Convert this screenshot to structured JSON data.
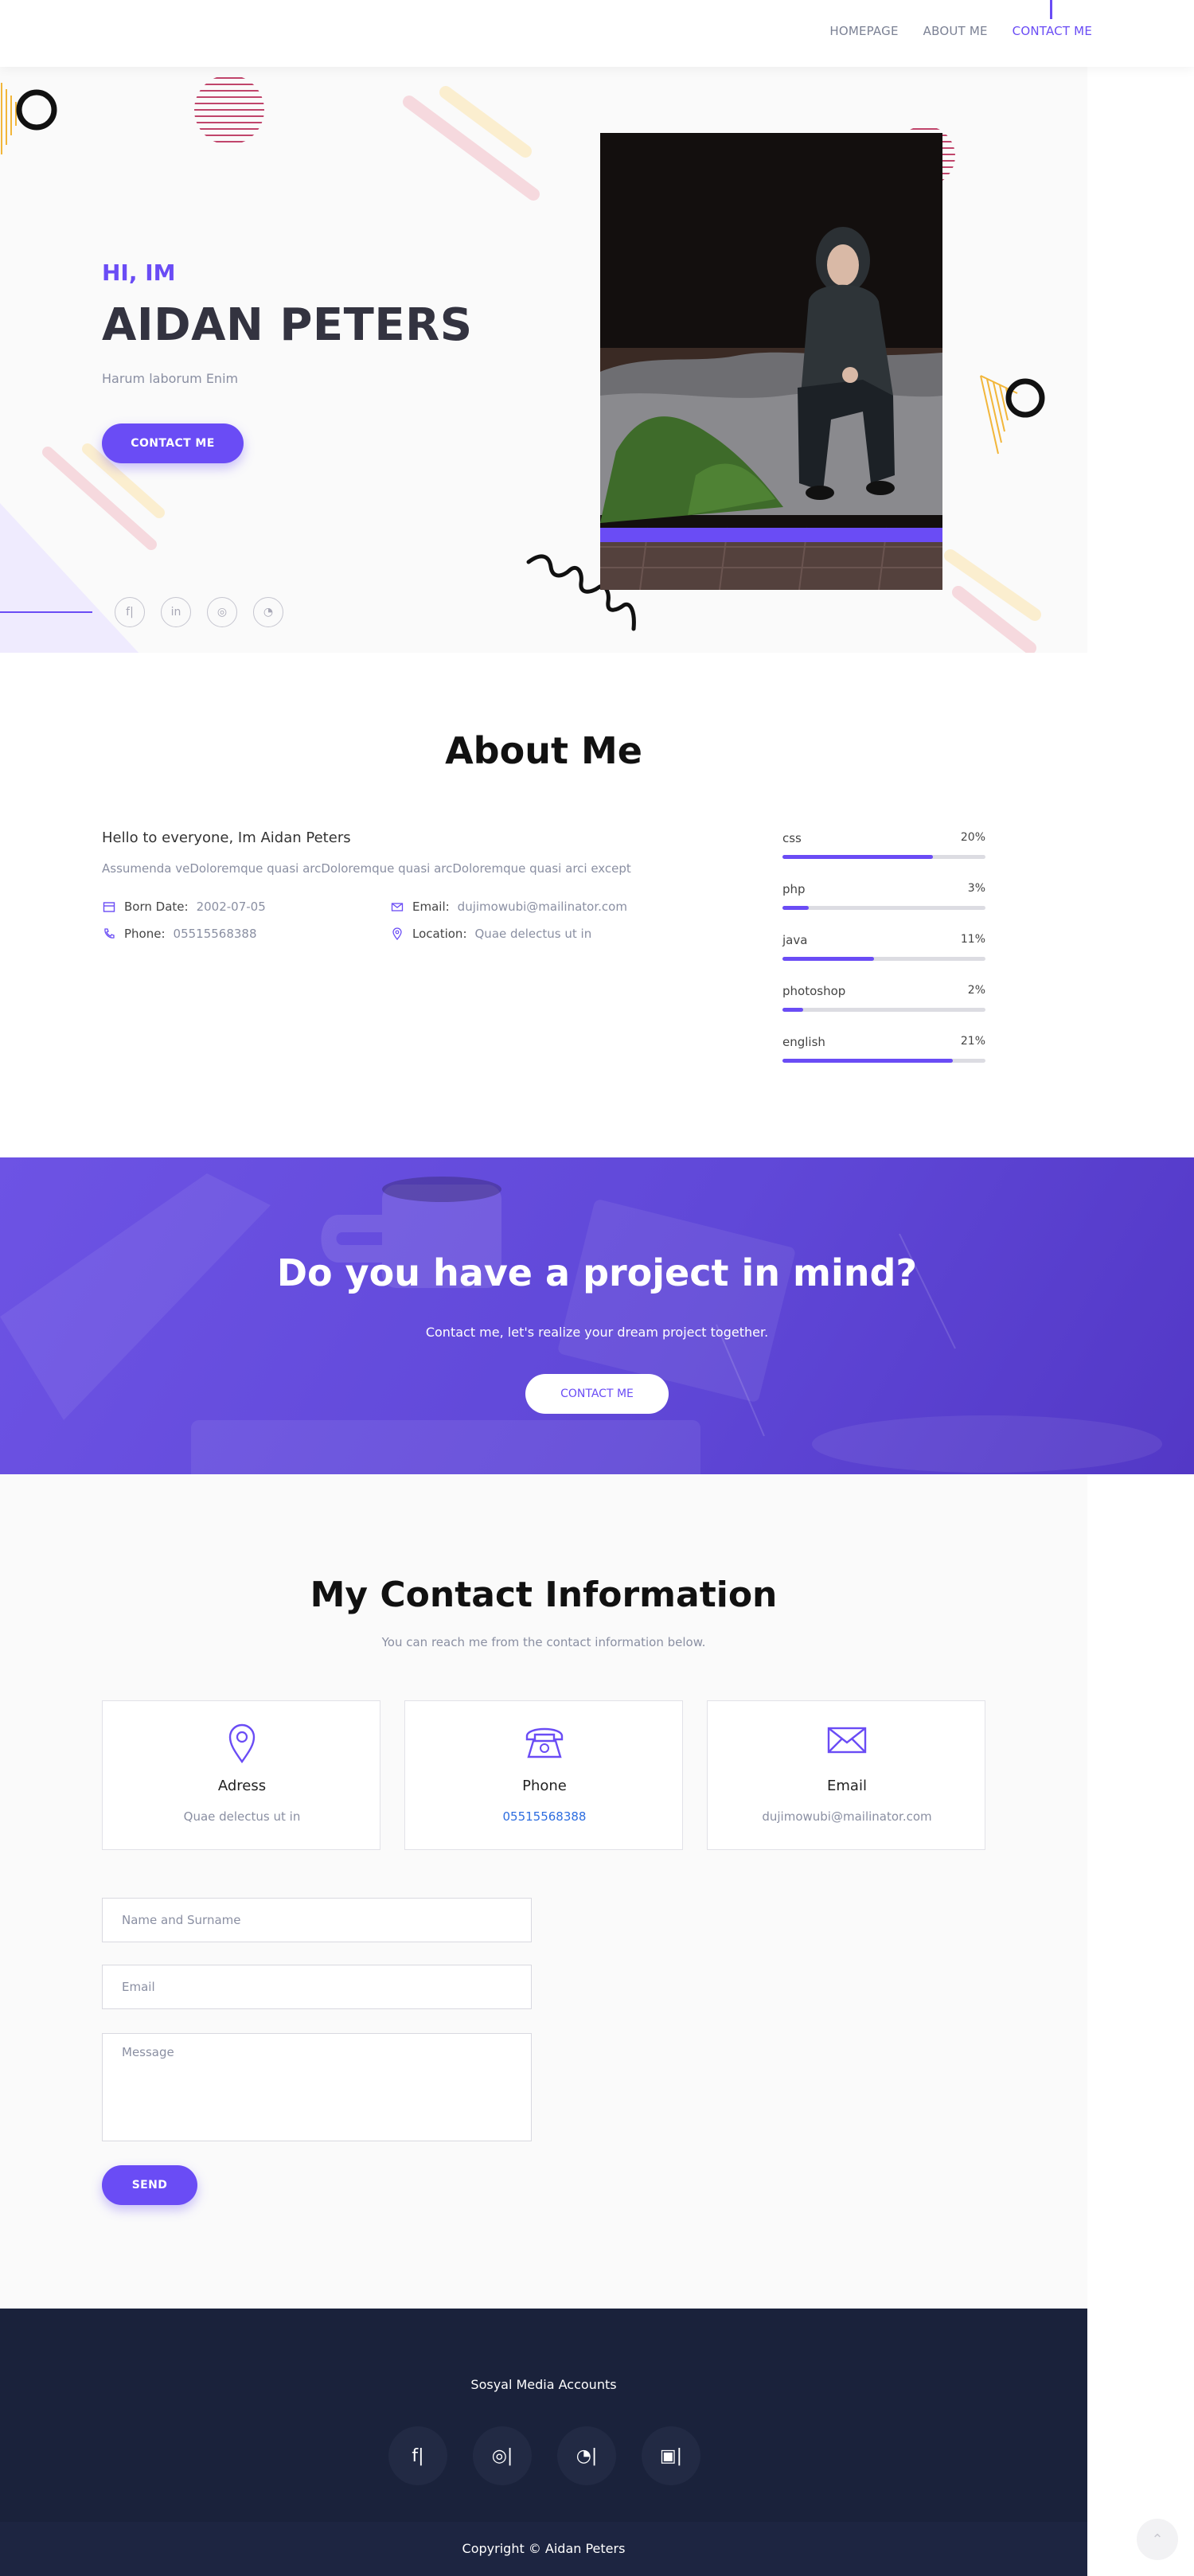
{
  "nav": {
    "items": [
      "HOMEPAGE",
      "ABOUT ME",
      "CONTACT ME"
    ],
    "active": "CONTACT ME"
  },
  "hero": {
    "greeting": "HI, IM",
    "name": "AIDAN PETERS",
    "tagline": "Harum laborum Enim",
    "button": "CONTACT ME",
    "socials": [
      "facebook-icon",
      "linkedin-icon",
      "instagram-icon",
      "github-icon"
    ]
  },
  "about": {
    "title": "About Me",
    "hello": "Hello to everyone, Im Aidan Peters",
    "description": "Assumenda veDoloremque quasi arcDoloremque quasi arcDoloremque quasi arci except",
    "born_label": "Born Date:",
    "born_value": "2002-07-05",
    "phone_label": "Phone:",
    "phone_value": "05515568388",
    "email_label": "Email:",
    "email_value": "dujimowubi@mailinator.com",
    "location_label": "Location:",
    "location_value": "Quae delectus ut in",
    "skills": [
      {
        "name": "css",
        "percent": "20%",
        "level": 0.74
      },
      {
        "name": "php",
        "percent": "3%",
        "level": 0.13
      },
      {
        "name": "java",
        "percent": "11%",
        "level": 0.45
      },
      {
        "name": "photoshop",
        "percent": "2%",
        "level": 0.1
      },
      {
        "name": "english",
        "percent": "21%",
        "level": 0.84
      }
    ]
  },
  "cta": {
    "title": "Do you have a project in mind?",
    "subtitle": "Contact me, let's realize your dream project together.",
    "button": "CONTACT ME"
  },
  "contact": {
    "title": "My Contact Information",
    "subtitle": "You can reach me from the contact information below.",
    "cards": [
      {
        "title": "Adress",
        "value": "Quae delectus ut in",
        "icon": "location-pin-icon"
      },
      {
        "title": "Phone",
        "value": "05515568388",
        "icon": "telephone-icon"
      },
      {
        "title": "Email",
        "value": "dujimowubi@mailinator.com",
        "icon": "envelope-icon"
      }
    ],
    "form": {
      "name_placeholder": "Name and Surname",
      "email_placeholder": "Email",
      "message_placeholder": "Message",
      "send": "SEND"
    }
  },
  "footer": {
    "title": "Sosyal Media Accounts",
    "socials": [
      "facebook-icon",
      "instagram-icon",
      "github-icon",
      "linkedin-icon"
    ],
    "copyright": "Copyright © Aidan Peters"
  },
  "colors": {
    "accent": "#6a4cf5",
    "footer": "#1a223b",
    "hero_bg": "#fafafa"
  }
}
